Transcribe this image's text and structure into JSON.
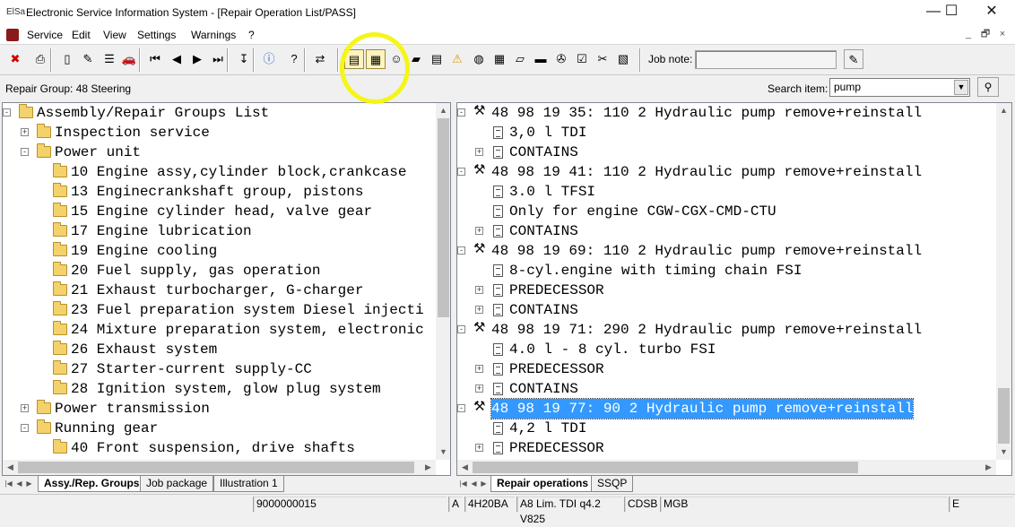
{
  "window": {
    "title": "Electronic Service Information System - [Repair Operation List/PASS]",
    "app_icon": "ElSa",
    "minimize": "—",
    "maximize": "☐",
    "close": "✕"
  },
  "menu": {
    "items": [
      "Service",
      "Edit",
      "View",
      "Settings",
      "Warnings",
      "?"
    ],
    "mdi_min": "_",
    "mdi_restore": "🗗",
    "mdi_close": "×"
  },
  "toolbar": {
    "job_note_label": "Job note:",
    "job_note_value": "",
    "buttons": [
      "exit-icon",
      "print-icon",
      "new-page-icon",
      "edit-icon",
      "notes-icon",
      "vehicle-icon",
      "first-icon",
      "prev-icon",
      "next-icon",
      "last-icon",
      "jump-icon",
      "info-icon",
      "help-icon",
      "exchange-icon",
      "repair-list-icon",
      "operation-icon",
      "mechanic-icon",
      "book-icon",
      "manual-icon",
      "warning-icon",
      "globe-icon",
      "calculator-icon",
      "parts-icon",
      "car-icon",
      "service-car-icon",
      "checklist-icon",
      "tools-icon",
      "clipboard-icon",
      "job-note-icon"
    ]
  },
  "info": {
    "repair_group": "Repair Group: 48 Steering",
    "search_label": "Search item:",
    "search_value": "pump"
  },
  "left_tree": [
    {
      "level": 0,
      "exp": "−",
      "icon": "book",
      "text": "Assembly/Repair Groups List"
    },
    {
      "level": 1,
      "exp": "+",
      "icon": "folder",
      "text": "Inspection service"
    },
    {
      "level": 1,
      "exp": "−",
      "icon": "folder",
      "text": "Power unit"
    },
    {
      "level": 2,
      "exp": "",
      "icon": "folder",
      "text": "10 Engine assy,cylinder block,crankcase"
    },
    {
      "level": 2,
      "exp": "",
      "icon": "folder",
      "text": "13 Enginecrankshaft group, pistons"
    },
    {
      "level": 2,
      "exp": "",
      "icon": "folder",
      "text": "15 Engine cylinder head, valve gear"
    },
    {
      "level": 2,
      "exp": "",
      "icon": "folder",
      "text": "17 Engine lubrication"
    },
    {
      "level": 2,
      "exp": "",
      "icon": "folder",
      "text": "19 Engine cooling"
    },
    {
      "level": 2,
      "exp": "",
      "icon": "folder",
      "text": "20 Fuel supply, gas operation"
    },
    {
      "level": 2,
      "exp": "",
      "icon": "folder",
      "text": "21 Exhaust turbocharger, G-charger"
    },
    {
      "level": 2,
      "exp": "",
      "icon": "folder",
      "text": "23 Fuel preparation system Diesel injecti"
    },
    {
      "level": 2,
      "exp": "",
      "icon": "folder",
      "text": "24 Mixture preparation system, electronic"
    },
    {
      "level": 2,
      "exp": "",
      "icon": "folder",
      "text": "26 Exhaust system"
    },
    {
      "level": 2,
      "exp": "",
      "icon": "folder",
      "text": "27 Starter-current supply-CC"
    },
    {
      "level": 2,
      "exp": "",
      "icon": "folder",
      "text": "28 Ignition system, glow plug system"
    },
    {
      "level": 1,
      "exp": "+",
      "icon": "folder",
      "text": "Power transmission"
    },
    {
      "level": 1,
      "exp": "−",
      "icon": "folder",
      "text": "Running gear"
    },
    {
      "level": 2,
      "exp": "",
      "icon": "folder",
      "text": "40 Front suspension, drive shafts"
    }
  ],
  "right_tree": [
    {
      "level": 0,
      "exp": "−",
      "icon": "tools",
      "text": "48 98 19 35:     110 2 Hydraulic pump remove+reinstall",
      "selected": false
    },
    {
      "level": 1,
      "exp": "",
      "icon": "doc",
      "text": "3,0 l TDI",
      "selected": false
    },
    {
      "level": 1,
      "exp": "+",
      "icon": "doc",
      "text": "CONTAINS",
      "selected": false
    },
    {
      "level": 0,
      "exp": "−",
      "icon": "tools",
      "text": "48 98 19 41:     110 2 Hydraulic pump remove+reinstall",
      "selected": false
    },
    {
      "level": 1,
      "exp": "",
      "icon": "doc",
      "text": "3.0 l TFSI",
      "selected": false
    },
    {
      "level": 1,
      "exp": "",
      "icon": "doc",
      "text": "Only for engine CGW-CGX-CMD-CTU",
      "selected": false
    },
    {
      "level": 1,
      "exp": "+",
      "icon": "doc",
      "text": "CONTAINS",
      "selected": false
    },
    {
      "level": 0,
      "exp": "−",
      "icon": "tools",
      "text": "48 98 19 69:     110 2 Hydraulic pump remove+reinstall",
      "selected": false
    },
    {
      "level": 1,
      "exp": "",
      "icon": "doc",
      "text": "8-cyl.engine with timing chain FSI",
      "selected": false
    },
    {
      "level": 1,
      "exp": "+",
      "icon": "doc",
      "text": "PREDECESSOR",
      "selected": false
    },
    {
      "level": 1,
      "exp": "+",
      "icon": "doc",
      "text": "CONTAINS",
      "selected": false
    },
    {
      "level": 0,
      "exp": "−",
      "icon": "tools",
      "text": "48 98 19 71:     290 2 Hydraulic pump remove+reinstall",
      "selected": false
    },
    {
      "level": 1,
      "exp": "",
      "icon": "doc",
      "text": "4.0 l - 8 cyl. turbo FSI",
      "selected": false
    },
    {
      "level": 1,
      "exp": "+",
      "icon": "doc",
      "text": "PREDECESSOR",
      "selected": false
    },
    {
      "level": 1,
      "exp": "+",
      "icon": "doc",
      "text": "CONTAINS",
      "selected": false
    },
    {
      "level": 0,
      "exp": "−",
      "icon": "tools",
      "text": "48 98 19 77:      90 2 Hydraulic pump remove+reinstall",
      "selected": true
    },
    {
      "level": 1,
      "exp": "",
      "icon": "doc",
      "text": "4,2 l TDI",
      "selected": false
    },
    {
      "level": 1,
      "exp": "+",
      "icon": "doc",
      "text": "PREDECESSOR",
      "selected": false
    }
  ],
  "left_tabs": [
    "Assy./Rep. Groups",
    "Job package",
    "Illustration 1"
  ],
  "right_tabs": [
    "Repair operations",
    "SSQP"
  ],
  "status": {
    "cells": [
      "9000000015",
      "A",
      "4H20BA",
      "A8 Lim. TDI q4.2 V825",
      "CDSB",
      "MGB",
      "E"
    ]
  },
  "colors": {
    "selection": "#3399ff",
    "annotation": "#f5f519",
    "folder": "#f3d26b"
  }
}
